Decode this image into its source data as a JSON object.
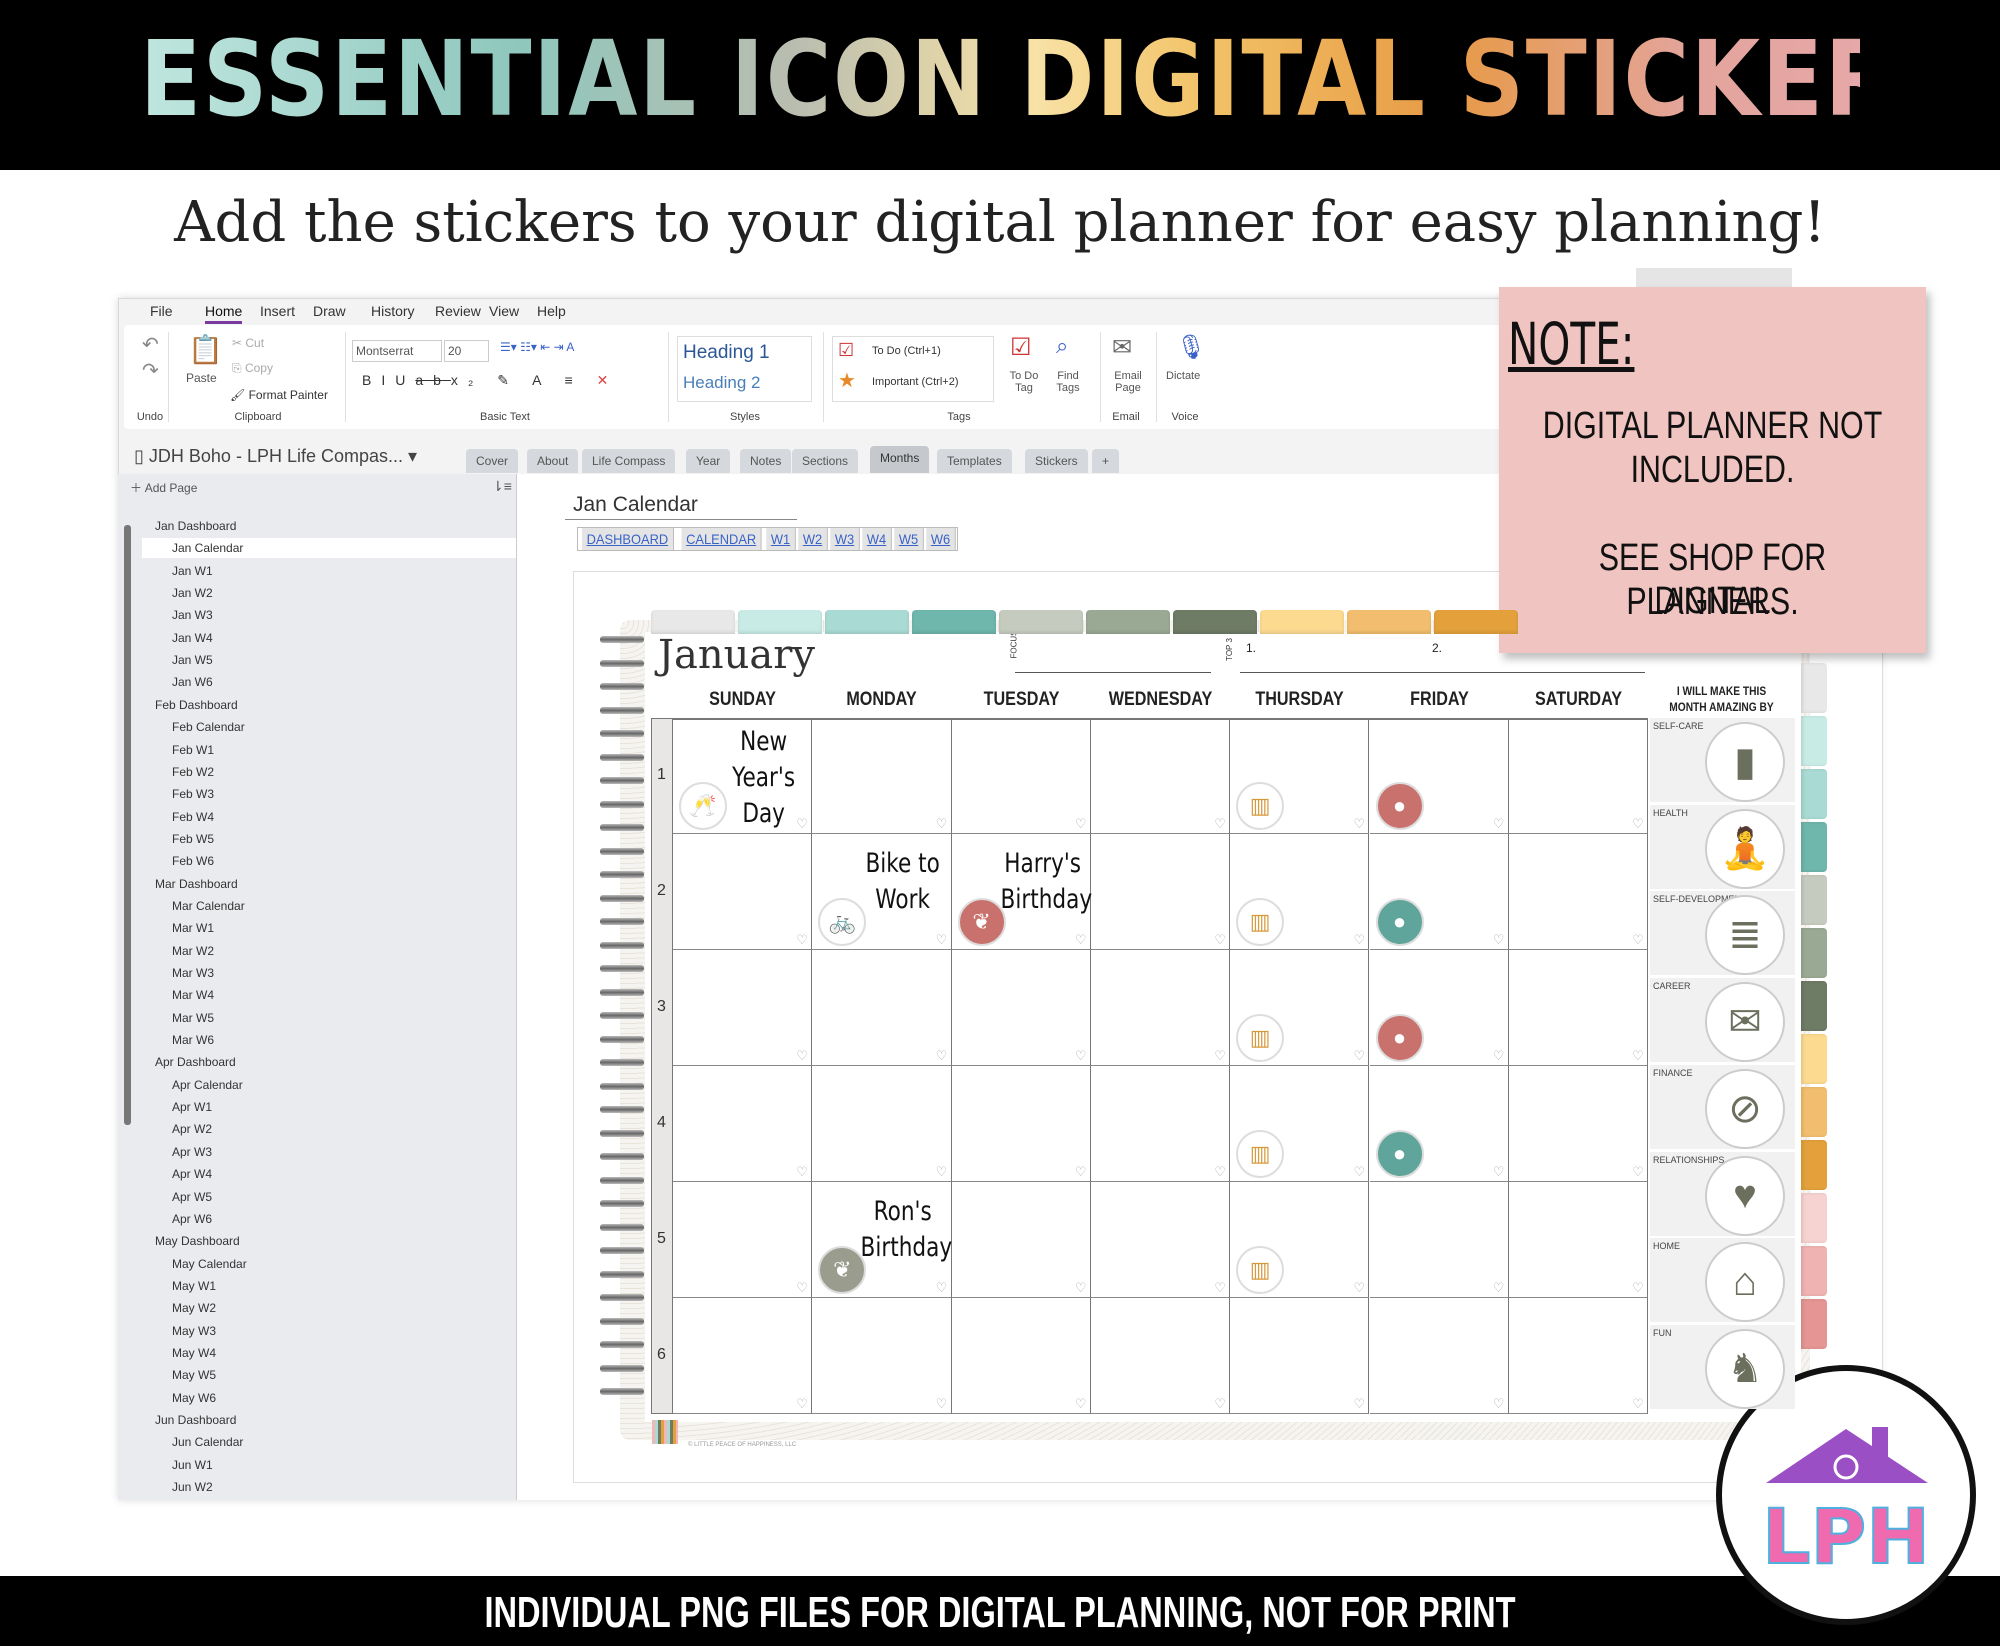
{
  "banner": {
    "title": "ESSENTIAL ICON DIGITAL STICKERS",
    "subtitle": "Add the stickers to your digital planner for easy planning!",
    "footer": "INDIVIDUAL PNG FILES FOR DIGITAL PLANNING, NOT FOR PRINT"
  },
  "menu": [
    "File",
    "Home",
    "Insert",
    "Draw",
    "History",
    "Review",
    "View",
    "Help"
  ],
  "menu_selected": "Home",
  "ribbon": {
    "undo": "Undo",
    "paste": "Paste",
    "cut": "Cut",
    "copy": "Copy",
    "format_painter": "Format Painter",
    "font": "Montserrat",
    "size": "20",
    "heading1": "Heading 1",
    "heading2": "Heading 2",
    "todo": "To Do (Ctrl+1)",
    "important": "Important (Ctrl+2)",
    "todo_tag": "To Do Tag",
    "find_tags": "Find Tags",
    "email_page": "Email Page",
    "dictate": "Dictate",
    "groups": {
      "undo": "Undo",
      "clipboard": "Clipboard",
      "basic_text": "Basic Text",
      "styles": "Styles",
      "tags": "Tags",
      "email": "Email",
      "voice": "Voice"
    }
  },
  "notebook": "JDH Boho - LPH Life Compas...",
  "sections": [
    "Cover",
    "About",
    "Life Compass",
    "Year",
    "Notes",
    "Sections",
    "Months",
    "Templates",
    "Stickers",
    "+"
  ],
  "section_selected": "Months",
  "sidebar": {
    "add_page": "Add Page",
    "pages": [
      {
        "t": "Jan Dashboard",
        "l": 0
      },
      {
        "t": "Jan Calendar",
        "l": 1,
        "cur": true
      },
      {
        "t": "Jan W1",
        "l": 1
      },
      {
        "t": "Jan W2",
        "l": 1
      },
      {
        "t": "Jan W3",
        "l": 1
      },
      {
        "t": "Jan W4",
        "l": 1
      },
      {
        "t": "Jan W5",
        "l": 1
      },
      {
        "t": "Jan W6",
        "l": 1
      },
      {
        "t": "Feb Dashboard",
        "l": 0
      },
      {
        "t": "Feb Calendar",
        "l": 1
      },
      {
        "t": "Feb W1",
        "l": 1
      },
      {
        "t": "Feb W2",
        "l": 1
      },
      {
        "t": "Feb W3",
        "l": 1
      },
      {
        "t": "Feb W4",
        "l": 1
      },
      {
        "t": "Feb W5",
        "l": 1
      },
      {
        "t": "Feb W6",
        "l": 1
      },
      {
        "t": "Mar Dashboard",
        "l": 0
      },
      {
        "t": "Mar Calendar",
        "l": 1
      },
      {
        "t": "Mar W1",
        "l": 1
      },
      {
        "t": "Mar W2",
        "l": 1
      },
      {
        "t": "Mar W3",
        "l": 1
      },
      {
        "t": "Mar W4",
        "l": 1
      },
      {
        "t": "Mar W5",
        "l": 1
      },
      {
        "t": "Mar W6",
        "l": 1
      },
      {
        "t": "Apr Dashboard",
        "l": 0
      },
      {
        "t": "Apr Calendar",
        "l": 1
      },
      {
        "t": "Apr W1",
        "l": 1
      },
      {
        "t": "Apr W2",
        "l": 1
      },
      {
        "t": "Apr W3",
        "l": 1
      },
      {
        "t": "Apr W4",
        "l": 1
      },
      {
        "t": "Apr W5",
        "l": 1
      },
      {
        "t": "Apr W6",
        "l": 1
      },
      {
        "t": "May Dashboard",
        "l": 0
      },
      {
        "t": "May Calendar",
        "l": 1
      },
      {
        "t": "May W1",
        "l": 1
      },
      {
        "t": "May W2",
        "l": 1
      },
      {
        "t": "May W3",
        "l": 1
      },
      {
        "t": "May W4",
        "l": 1
      },
      {
        "t": "May W5",
        "l": 1
      },
      {
        "t": "May W6",
        "l": 1
      },
      {
        "t": "Jun Dashboard",
        "l": 0
      },
      {
        "t": "Jun Calendar",
        "l": 1
      },
      {
        "t": "Jun W1",
        "l": 1
      },
      {
        "t": "Jun W2",
        "l": 1
      }
    ]
  },
  "page": {
    "title": "Jan Calendar",
    "nav": [
      "DASHBOARD",
      "CALENDAR",
      "W1",
      "W2",
      "W3",
      "W4",
      "W5",
      "W6"
    ]
  },
  "planner": {
    "month": "January",
    "focus": "FOCUS",
    "top3": "TOP 3",
    "top1": "1.",
    "top2": "2.",
    "days": [
      "SUNDAY",
      "MONDAY",
      "TUESDAY",
      "WEDNESDAY",
      "THURSDAY",
      "FRIDAY",
      "SATURDAY"
    ],
    "weeks": [
      "1",
      "2",
      "3",
      "4",
      "5",
      "6"
    ],
    "amazing_header": "I WILL MAKE THIS MONTH AMAZING BY",
    "life_areas": [
      {
        "label": "SELF-CARE",
        "icon": "nail-polish-icon",
        "g": "▮"
      },
      {
        "label": "HEALTH",
        "icon": "yoga-icon",
        "g": "🧘"
      },
      {
        "label": "SELF-DEVELOPMENT",
        "icon": "books-icon",
        "g": "≣"
      },
      {
        "label": "CAREER",
        "icon": "email-envelope-icon",
        "g": "✉"
      },
      {
        "label": "FINANCE",
        "icon": "no-credit-card-icon",
        "g": "⊘"
      },
      {
        "label": "RELATIONSHIPS",
        "icon": "heart-icon",
        "g": "♥"
      },
      {
        "label": "HOME",
        "icon": "bucket-mop-icon",
        "g": "⌂"
      },
      {
        "label": "FUN",
        "icon": "chess-icon",
        "g": "♞"
      }
    ],
    "copyright": "© LITTLE PEACE OF HAPPINESS, LLC",
    "tab_colors": [
      "#e8e8e8",
      "#c8ebe6",
      "#a9dad4",
      "#6fb6ac",
      "#c6cbc0",
      "#9aa993",
      "#6e7b65",
      "#fcda90",
      "#f2bd6e",
      "#e4a13b",
      "#f6d2d0",
      "#efb3b1",
      "#e59593"
    ],
    "stickers": [
      {
        "week": 0,
        "day": 0,
        "icon": "champagne-icon",
        "g": "🥂",
        "color": "#ffffff",
        "fg": "#c46d6a",
        "label": [
          "New",
          "Year's",
          "Day"
        ]
      },
      {
        "week": 0,
        "day": 4,
        "icon": "gift-icon",
        "g": "▥",
        "color": "#ffffff",
        "fg": "#d49a3c"
      },
      {
        "week": 0,
        "day": 5,
        "icon": "piggy-bank-icon",
        "g": "●",
        "color": "#c8716d",
        "fg": "#fff"
      },
      {
        "week": 1,
        "day": 1,
        "icon": "bike-icon",
        "g": "🚲",
        "color": "#ffffff",
        "fg": "#5fa59b",
        "label": [
          "Bike to",
          "Work"
        ]
      },
      {
        "week": 1,
        "day": 2,
        "icon": "balloons-icon",
        "g": "❦",
        "color": "#c8716d",
        "fg": "#fff",
        "label": [
          "Harry's",
          "Birthday"
        ]
      },
      {
        "week": 1,
        "day": 4,
        "icon": "gift-icon",
        "g": "▥",
        "color": "#ffffff",
        "fg": "#d49a3c"
      },
      {
        "week": 1,
        "day": 5,
        "icon": "piggy-bank-icon",
        "g": "●",
        "color": "#5fa59b",
        "fg": "#fff"
      },
      {
        "week": 2,
        "day": 4,
        "icon": "gift-icon",
        "g": "▥",
        "color": "#ffffff",
        "fg": "#d49a3c"
      },
      {
        "week": 2,
        "day": 5,
        "icon": "piggy-bank-icon",
        "g": "●",
        "color": "#c8716d",
        "fg": "#fff"
      },
      {
        "week": 3,
        "day": 4,
        "icon": "gift-icon",
        "g": "▥",
        "color": "#ffffff",
        "fg": "#d49a3c"
      },
      {
        "week": 3,
        "day": 5,
        "icon": "piggy-bank-icon",
        "g": "●",
        "color": "#5fa59b",
        "fg": "#fff"
      },
      {
        "week": 4,
        "day": 1,
        "icon": "balloons-icon",
        "g": "❦",
        "color": "#9a9c8e",
        "fg": "#fff",
        "label": [
          "Ron's",
          "Birthday"
        ]
      },
      {
        "week": 4,
        "day": 4,
        "icon": "gift-icon",
        "g": "▥",
        "color": "#ffffff",
        "fg": "#d49a3c"
      }
    ]
  },
  "note": {
    "title": "NOTE:",
    "lines": [
      "DIGITAL PLANNER NOT",
      "INCLUDED.",
      "",
      "SEE SHOP FOR DIGITAL",
      "PLANNERS."
    ],
    "color": "#f0c4c0"
  },
  "logo": {
    "text": "LPH"
  }
}
